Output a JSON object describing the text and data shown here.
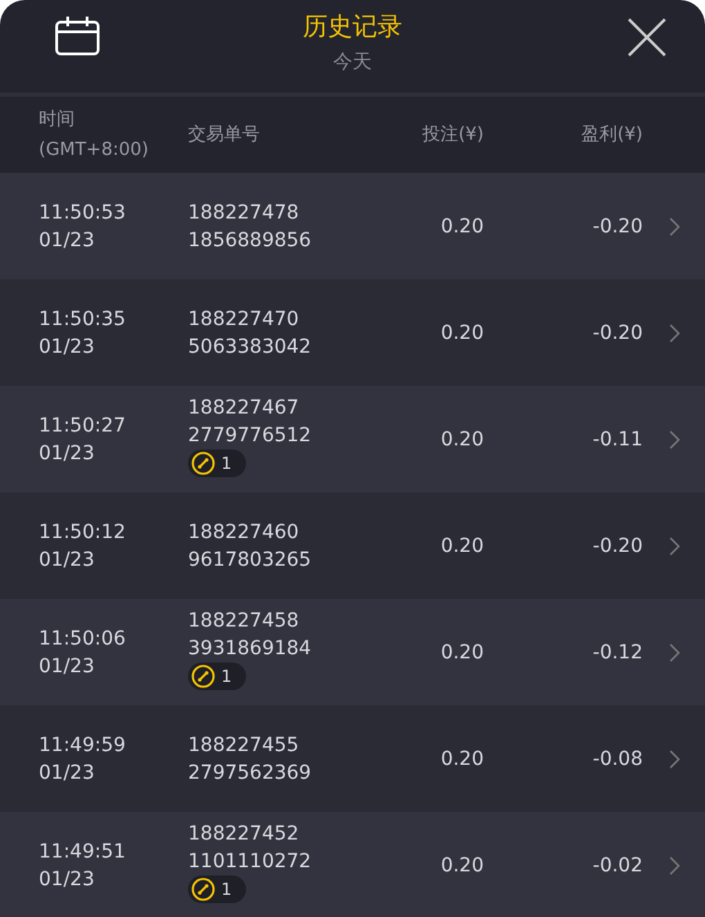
{
  "header": {
    "title": "历史记录",
    "subtitle": "今天"
  },
  "columns": [
    {
      "lines": [
        "时间",
        "(GMT+8:00)"
      ]
    },
    {
      "lines": [
        "交易单号"
      ]
    },
    {
      "lines": [
        "投注(¥)"
      ]
    },
    {
      "lines": [
        "盈利(¥)"
      ]
    }
  ],
  "rows": [
    {
      "time": "11:50:53",
      "date": "01/23",
      "ids": [
        "188227478",
        "1856889856"
      ],
      "bet": "0.20",
      "profit": "-0.20"
    },
    {
      "time": "11:50:35",
      "date": "01/23",
      "ids": [
        "188227470",
        "5063383042"
      ],
      "bet": "0.20",
      "profit": "-0.20"
    },
    {
      "time": "11:50:27",
      "date": "01/23",
      "ids": [
        "188227467",
        "2779776512"
      ],
      "badge": "1",
      "bet": "0.20",
      "profit": "-0.11"
    },
    {
      "time": "11:50:12",
      "date": "01/23",
      "ids": [
        "188227460",
        "9617803265"
      ],
      "bet": "0.20",
      "profit": "-0.20"
    },
    {
      "time": "11:50:06",
      "date": "01/23",
      "ids": [
        "188227458",
        "3931869184"
      ],
      "badge": "1",
      "bet": "0.20",
      "profit": "-0.12"
    },
    {
      "time": "11:49:59",
      "date": "01/23",
      "ids": [
        "188227455",
        "2797562369"
      ],
      "bet": "0.20",
      "profit": "-0.08"
    },
    {
      "time": "11:49:51",
      "date": "01/23",
      "ids": [
        "188227452",
        "1101110272"
      ],
      "badge": "1",
      "bet": "0.20",
      "profit": "-0.02"
    }
  ]
}
